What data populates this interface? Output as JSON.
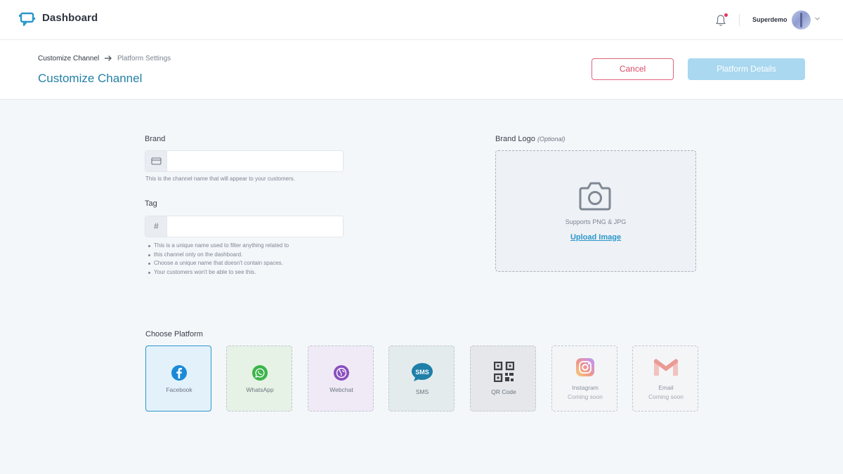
{
  "nav": {
    "app_title": "Dashboard",
    "user_name": "Superdemo",
    "notification_dot_color": "#e4375a"
  },
  "header": {
    "breadcrumb_current": "Customize Channel",
    "breadcrumb_next": "Platform Settings",
    "page_title": "Customize Channel",
    "cancel_label": "Cancel",
    "details_label": "Platform Details"
  },
  "brand": {
    "label": "Brand",
    "icon": "card-icon",
    "value": "",
    "help": "This is the channel name that will appear to your customers."
  },
  "tag": {
    "label": "Tag",
    "addon": "#",
    "value": "",
    "notes": [
      "This is a unique name used to filter anything related to",
      "this channel only on the dashboard.",
      "Choose a unique name that doesn't contain spaces.",
      "Your customers won't be able to see this."
    ]
  },
  "logo": {
    "label": "Brand Logo",
    "optional": "(Optional)",
    "icon": "camera-icon",
    "support": "Supports PNG & JPG",
    "upload": "Upload Image"
  },
  "platform": {
    "label": "Choose Platform",
    "selected": "Facebook",
    "items": [
      {
        "label": "Facebook",
        "sub": "",
        "icon": "facebook-icon"
      },
      {
        "label": "WhatsApp",
        "sub": "",
        "icon": "whatsapp-icon"
      },
      {
        "label": "Webchat",
        "sub": "",
        "icon": "webchat-icon"
      },
      {
        "label": "SMS",
        "sub": "",
        "icon": "sms-icon"
      },
      {
        "label": "QR Code",
        "sub": "",
        "icon": "qr-code-icon"
      },
      {
        "label": "Instagram",
        "sub": "Coming soon",
        "icon": "instagram-icon"
      },
      {
        "label": "Email",
        "sub": "Coming soon",
        "icon": "gmail-icon"
      }
    ]
  },
  "colors": {
    "accent": "#2380a6",
    "link": "#2a97cc",
    "cancel": "#d94966",
    "primary_disabled": "#a9d8f0"
  }
}
